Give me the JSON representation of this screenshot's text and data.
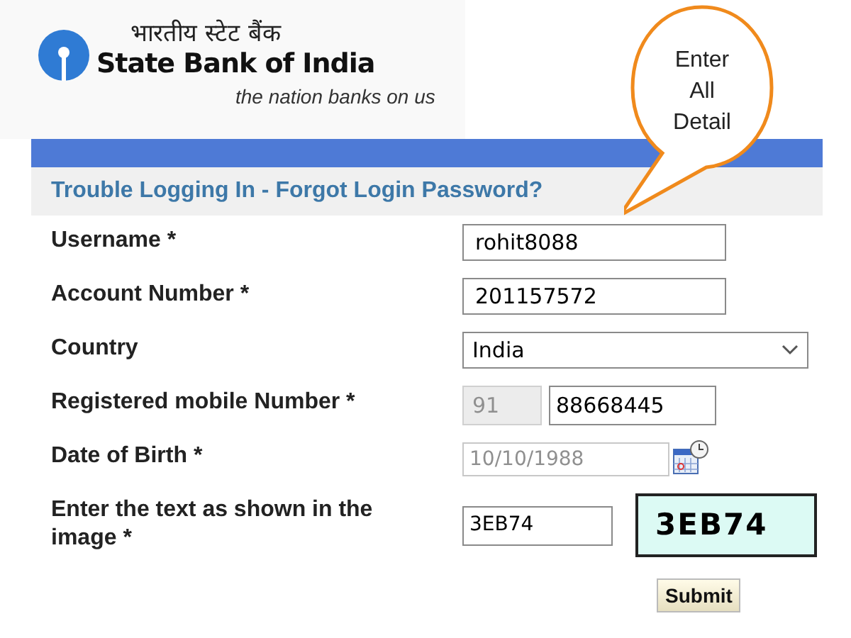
{
  "brand": {
    "hindi_name": "भारतीय स्टेट बैंक",
    "name": "State Bank of India",
    "tagline": "the nation banks on us"
  },
  "callout": {
    "text": "Enter All Detail"
  },
  "form": {
    "title": "Trouble Logging In - Forgot Login Password?",
    "rows": [
      {
        "kind": "text",
        "label": "Username *",
        "value": "rohit8088",
        "disabled": false
      },
      {
        "kind": "text",
        "label": "Account Number *",
        "value": "201157572",
        "disabled": false
      },
      {
        "kind": "select",
        "label": "Country",
        "value": "India",
        "disabled": false
      },
      {
        "kind": "phone",
        "label": "Registered mobile Number *",
        "code": "91",
        "value": "88668445",
        "disabled": false
      },
      {
        "kind": "date",
        "label": "Date of Birth *",
        "value": "10/10/1988",
        "disabled": true
      },
      {
        "kind": "captcha",
        "label": "Enter the text as shown in the image *",
        "value": "3EB74",
        "captcha": "3EB74",
        "disabled": false
      }
    ],
    "submit": "Submit"
  }
}
